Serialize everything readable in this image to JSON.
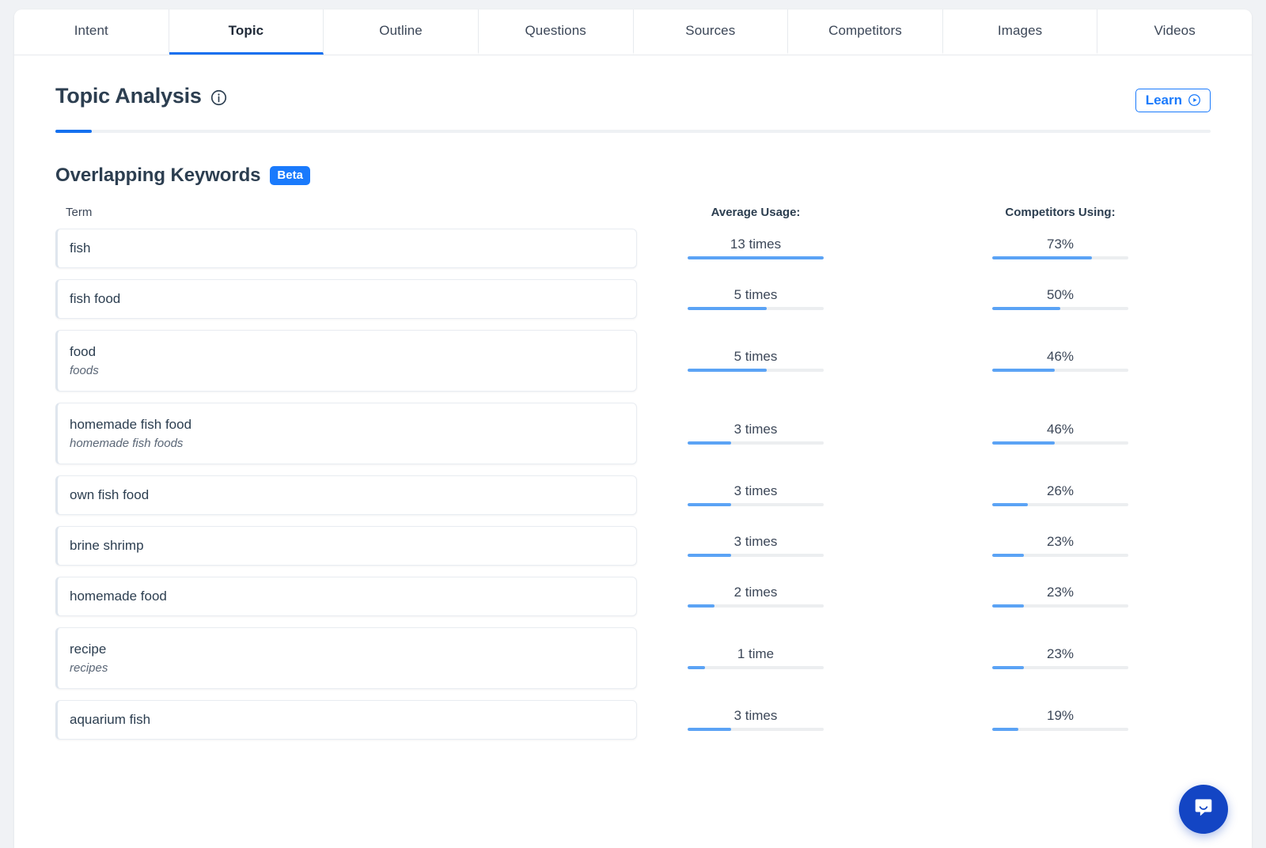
{
  "tabs": [
    {
      "label": "Intent",
      "active": false
    },
    {
      "label": "Topic",
      "active": true
    },
    {
      "label": "Outline",
      "active": false
    },
    {
      "label": "Questions",
      "active": false
    },
    {
      "label": "Sources",
      "active": false
    },
    {
      "label": "Competitors",
      "active": false
    },
    {
      "label": "Images",
      "active": false
    },
    {
      "label": "Videos",
      "active": false
    }
  ],
  "header": {
    "title": "Topic Analysis",
    "info_icon": "info-circle-icon",
    "learn_label": "Learn",
    "learn_icon": "play-circle-icon",
    "accent_color": "#1570ef"
  },
  "section": {
    "title": "Overlapping Keywords",
    "badge": "Beta",
    "badge_color": "#1a7afc"
  },
  "columns": {
    "term": "Term",
    "average_usage": "Average Usage:",
    "competitors_using": "Competitors Using:"
  },
  "chat": {
    "icon": "chat-bubble-icon",
    "color": "#1345c4"
  },
  "chart_data": {
    "type": "bar",
    "title": "Overlapping Keywords",
    "series": [
      {
        "name": "Average Usage:",
        "unit": "times"
      },
      {
        "name": "Competitors Using:",
        "unit": "%"
      }
    ],
    "rows": [
      {
        "term": "fish",
        "variant": "",
        "usage_label": "13 times",
        "usage_value": 13,
        "usage_pct": 100,
        "comp_label": "73%",
        "comp_value": 73
      },
      {
        "term": "fish food",
        "variant": "",
        "usage_label": "5 times",
        "usage_value": 5,
        "usage_pct": 58,
        "comp_label": "50%",
        "comp_value": 50
      },
      {
        "term": "food",
        "variant": "foods",
        "usage_label": "5 times",
        "usage_value": 5,
        "usage_pct": 58,
        "comp_label": "46%",
        "comp_value": 46
      },
      {
        "term": "homemade fish food",
        "variant": "homemade fish foods",
        "usage_label": "3 times",
        "usage_value": 3,
        "usage_pct": 32,
        "comp_label": "46%",
        "comp_value": 46
      },
      {
        "term": "own fish food",
        "variant": "",
        "usage_label": "3 times",
        "usage_value": 3,
        "usage_pct": 32,
        "comp_label": "26%",
        "comp_value": 26
      },
      {
        "term": "brine shrimp",
        "variant": "",
        "usage_label": "3 times",
        "usage_value": 3,
        "usage_pct": 32,
        "comp_label": "23%",
        "comp_value": 23
      },
      {
        "term": "homemade food",
        "variant": "",
        "usage_label": "2 times",
        "usage_value": 2,
        "usage_pct": 20,
        "comp_label": "23%",
        "comp_value": 23
      },
      {
        "term": "recipe",
        "variant": "recipes",
        "usage_label": "1 time",
        "usage_value": 1,
        "usage_pct": 13,
        "comp_label": "23%",
        "comp_value": 23
      },
      {
        "term": "aquarium fish",
        "variant": "",
        "usage_label": "3 times",
        "usage_value": 3,
        "usage_pct": 32,
        "comp_label": "19%",
        "comp_value": 19
      }
    ]
  }
}
